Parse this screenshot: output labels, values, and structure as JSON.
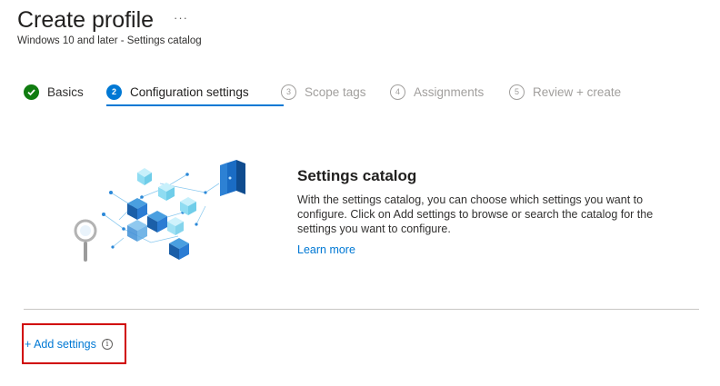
{
  "header": {
    "title": "Create profile",
    "more_label": "···",
    "subtitle": "Windows 10 and later - Settings catalog"
  },
  "steps": [
    {
      "number": "✓",
      "label": "Basics",
      "state": "done"
    },
    {
      "number": "2",
      "label": "Configuration settings",
      "state": "current"
    },
    {
      "number": "3",
      "label": "Scope tags",
      "state": "pending"
    },
    {
      "number": "4",
      "label": "Assignments",
      "state": "pending"
    },
    {
      "number": "5",
      "label": "Review + create",
      "state": "pending"
    }
  ],
  "catalog": {
    "title": "Settings catalog",
    "description": "With the settings catalog, you can choose which settings you want to configure. Click on Add settings to browse or search the catalog for the settings you want to configure.",
    "learn_more": "Learn more"
  },
  "add_settings": {
    "label": "+ Add settings",
    "info_icon": "i"
  },
  "colors": {
    "accent": "#0078d4",
    "success": "#107c10",
    "highlight": "#d00000"
  }
}
